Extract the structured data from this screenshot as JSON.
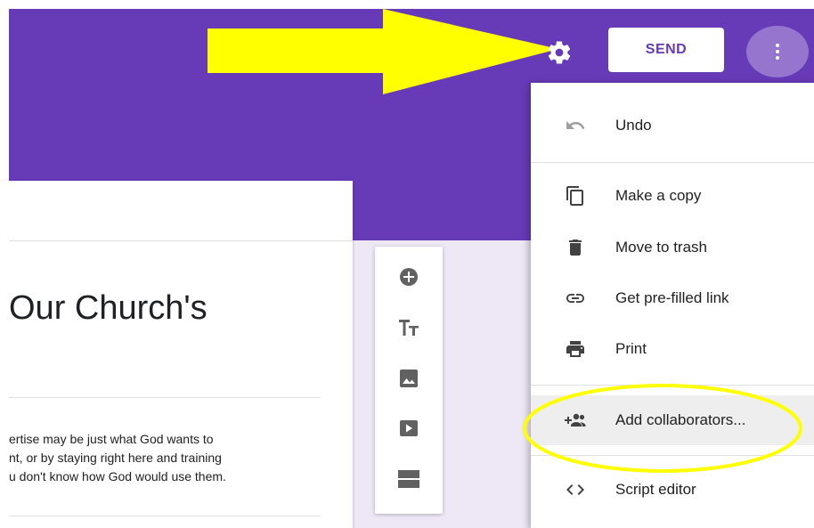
{
  "header": {
    "send_label": "SEND",
    "accent_color": "#673ab7"
  },
  "form": {
    "title": "Our Church's",
    "description_lines": [
      "ertise may be just what God wants to",
      "nt, or by staying right here and training",
      "u don't know how God would use them."
    ]
  },
  "toolbar": {
    "items": [
      "add-question-icon",
      "title-text-icon",
      "image-icon",
      "video-icon",
      "section-icon"
    ]
  },
  "menu": {
    "items": [
      {
        "label": "Undo",
        "icon": "undo-icon"
      },
      {
        "label": "Make a copy",
        "icon": "copy-icon"
      },
      {
        "label": "Move to trash",
        "icon": "trash-icon"
      },
      {
        "label": "Get pre-filled link",
        "icon": "link-icon"
      },
      {
        "label": "Print",
        "icon": "print-icon"
      },
      {
        "label": "Add collaborators...",
        "icon": "add-collaborators-icon"
      },
      {
        "label": "Script editor",
        "icon": "code-icon"
      }
    ]
  },
  "annotations": {
    "arrow_color": "#ffff00",
    "circle_color": "#ffff00"
  }
}
